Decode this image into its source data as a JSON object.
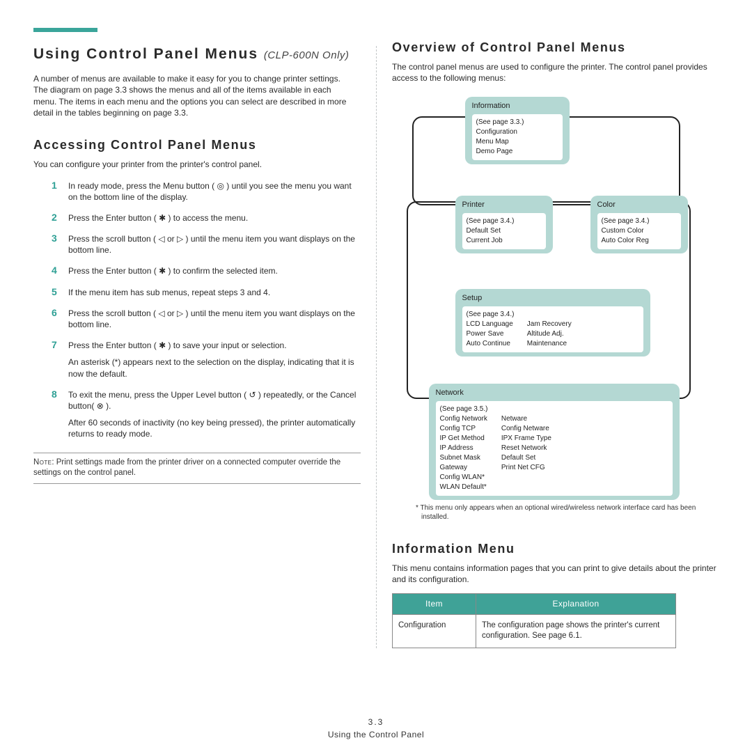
{
  "left": {
    "title_pre": "Using Control Panel Menus ",
    "title_model": "(CLP-600N Only)",
    "intro": "A number of menus are available to make it easy for you to change printer settings. The diagram on page 3.3 shows the menus and all of the items available in each menu. The items in each menu and the options you can select are described in more detail in the tables beginning on page 3.3.",
    "h2_access": "Accessing Control Panel Menus",
    "access_lead": "You can configure your printer from the printer's control panel.",
    "steps": [
      "In ready mode, press the Menu button ( ◎ ) until you see the menu you want on the bottom line of the display.",
      "Press the Enter button ( ✱ ) to access the menu.",
      "Press the scroll button ( ◁ or ▷ ) until the menu item you want displays on the bottom line.",
      "Press the Enter button ( ✱ ) to confirm the selected item.",
      "If the menu item has sub menus, repeat steps 3 and 4.",
      "Press the scroll button ( ◁ or ▷ ) until the menu item you want displays on the bottom line.",
      "Press the Enter button ( ✱ ) to save your input or selection.",
      "To exit the menu, press the Upper Level button ( ↺ ) repeatedly, or the Cancel button( ⊗ )."
    ],
    "step7_extra": "An asterisk (*) appears next to the selection on the display, indicating that it is now the default.",
    "step8_extra": "After 60 seconds of inactivity (no key being pressed), the printer automatically returns to ready mode.",
    "note_label": "Note",
    "note_text": ": Print settings made from the printer driver on a connected computer override the settings on the control panel."
  },
  "right": {
    "h2_overview": "Overview of Control Panel Menus",
    "overview_lead": "The control panel menus are used to configure the printer. The control panel provides access to the following menus:",
    "diagram": {
      "info": {
        "hdr": "Information",
        "see": "(See page 3.3.)",
        "items": "Configuration\nMenu Map\nDemo Page"
      },
      "printer": {
        "hdr": "Printer",
        "see": "(See page 3.4.)",
        "items": "Default Set\nCurrent Job"
      },
      "color": {
        "hdr": "Color",
        "see": "(See page 3.4.)",
        "items": "Custom Color\nAuto Color Reg"
      },
      "setup": {
        "hdr": "Setup",
        "see": "(See page 3.4.)",
        "col1": "LCD Language\nPower Save\nAuto Continue",
        "col2": "Jam Recovery\nAltitude Adj.\nMaintenance"
      },
      "network": {
        "hdr": "Network",
        "see": "(See page 3.5.)",
        "col1": "Config Network\nConfig TCP\nIP Get Method\nIP Address\nSubnet Mask\nGateway\nConfig WLAN*\nWLAN Default*",
        "col2": "Netware\nConfig Netware\nIPX Frame Type\nReset Network\nDefault Set\nPrint Net CFG"
      }
    },
    "footnote": "* This menu only appears when an optional wired/wireless network interface card has been installed.",
    "h2_info": "Information Menu",
    "info_desc": "This menu contains information pages that you can print to give details about the printer and its configuration.",
    "table": {
      "h1": "Item",
      "h2": "Explanation",
      "r1c1": "Configuration",
      "r1c2": "The configuration page shows the printer's current configuration. See page 6.1."
    }
  },
  "footer": {
    "page": "3.3",
    "caption": "Using the Control Panel"
  }
}
